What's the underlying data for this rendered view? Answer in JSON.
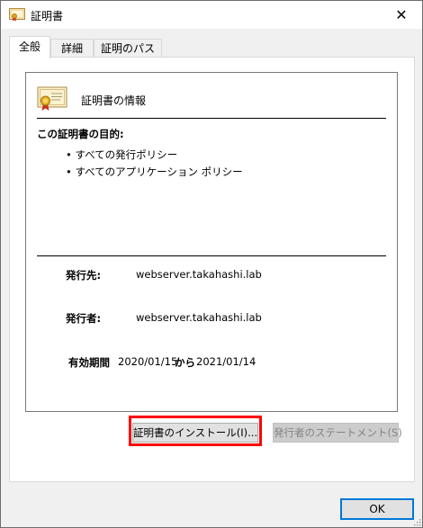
{
  "window": {
    "title": "証明書",
    "close_glyph": "✕"
  },
  "tabs": [
    {
      "label": "全般",
      "active": true
    },
    {
      "label": "詳細",
      "active": false
    },
    {
      "label": "証明のパス",
      "active": false
    }
  ],
  "general": {
    "info_title": "証明書の情報",
    "purpose_title": "この証明書の目的:",
    "purposes": [
      "• すべての発行ポリシー",
      "• すべてのアプリケーション ポリシー"
    ],
    "issued_to_label": "発行先:",
    "issued_to_value": "webserver.takahashi.lab",
    "issued_by_label": "発行者:",
    "issued_by_value": "webserver.takahashi.lab",
    "validity_label": "有効期間",
    "valid_from": "2020/01/15",
    "validity_connector": "から",
    "valid_to": "2021/01/14"
  },
  "buttons": {
    "install": "証明書のインストール(I)...",
    "issuer_statement": "発行者のステートメント(S)",
    "ok": "OK"
  },
  "colors": {
    "highlight": "#ff0000",
    "ok_border": "#0078d7"
  },
  "icons": {
    "title": "certificate-icon",
    "info": "certificate-icon"
  }
}
